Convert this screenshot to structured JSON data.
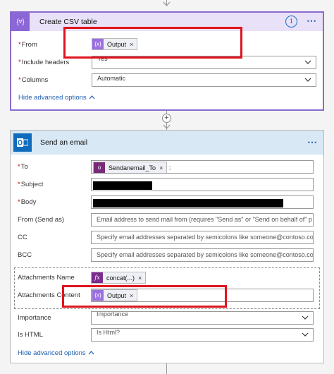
{
  "csv_card": {
    "title": "Create CSV table",
    "icon": "table-braces-icon",
    "info_icon": "info-icon",
    "more": "⋯",
    "fields": {
      "from": {
        "label": "From",
        "required": true,
        "token": "Output",
        "token_icon": "expression-icon"
      },
      "include_headers": {
        "label": "Include headers",
        "required": true,
        "value": "Yes"
      },
      "columns": {
        "label": "Columns",
        "required": true,
        "value": "Automatic"
      }
    },
    "advanced_link": "Hide advanced options"
  },
  "email_card": {
    "title": "Send an email",
    "icon": "outlook-icon",
    "more": "⋯",
    "fields": {
      "to": {
        "label": "To",
        "required": true,
        "token": "Sendanemail_To",
        "suffix": ";"
      },
      "subject": {
        "label": "Subject",
        "required": true
      },
      "body": {
        "label": "Body",
        "required": true
      },
      "from_send_as": {
        "label": "From (Send as)",
        "placeholder": "Email address to send mail from (requires \"Send as\" or \"Send on behalf of\" p"
      },
      "cc": {
        "label": "CC",
        "placeholder": "Specify email addresses separated by semicolons like someone@contoso.com"
      },
      "bcc": {
        "label": "BCC",
        "placeholder": "Specify email addresses separated by semicolons like someone@contoso.com"
      },
      "attachments_name": {
        "label": "Attachments Name",
        "token": "concat(...)"
      },
      "attachments_content": {
        "label": "Attachments Content",
        "token": "Output"
      },
      "importance": {
        "label": "Importance",
        "placeholder": "Importance"
      },
      "is_html": {
        "label": "Is HTML",
        "placeholder": "Is Html?"
      }
    },
    "advanced_link": "Hide advanced options"
  },
  "connector": {
    "plus": "+"
  },
  "colors": {
    "csv_accent": "#8a66d6",
    "email_accent": "#0f6cbd",
    "highlight": "#e0141e",
    "link": "#1f5fb0"
  }
}
